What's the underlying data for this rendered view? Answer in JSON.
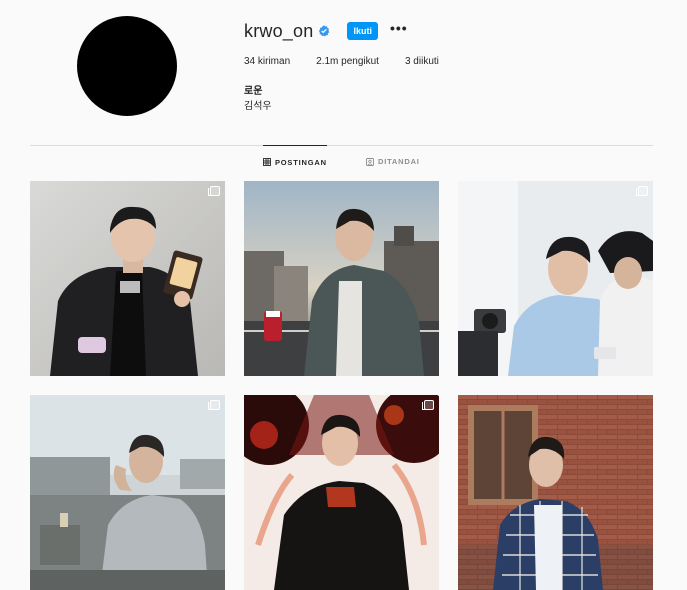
{
  "profile": {
    "username": "krwo_on",
    "follow_label": "Ikuti",
    "more_label": "•••",
    "stats": {
      "posts": "34 kiriman",
      "followers": "2.1m pengikut",
      "following": "3 diikuti"
    },
    "bio_name": "로운",
    "bio_line": "김석우"
  },
  "tabs": {
    "posts": "POSTINGAN",
    "tagged": "DITANDAI"
  },
  "colors": {
    "accent": "#0095f6",
    "verified": "#3897f0"
  }
}
